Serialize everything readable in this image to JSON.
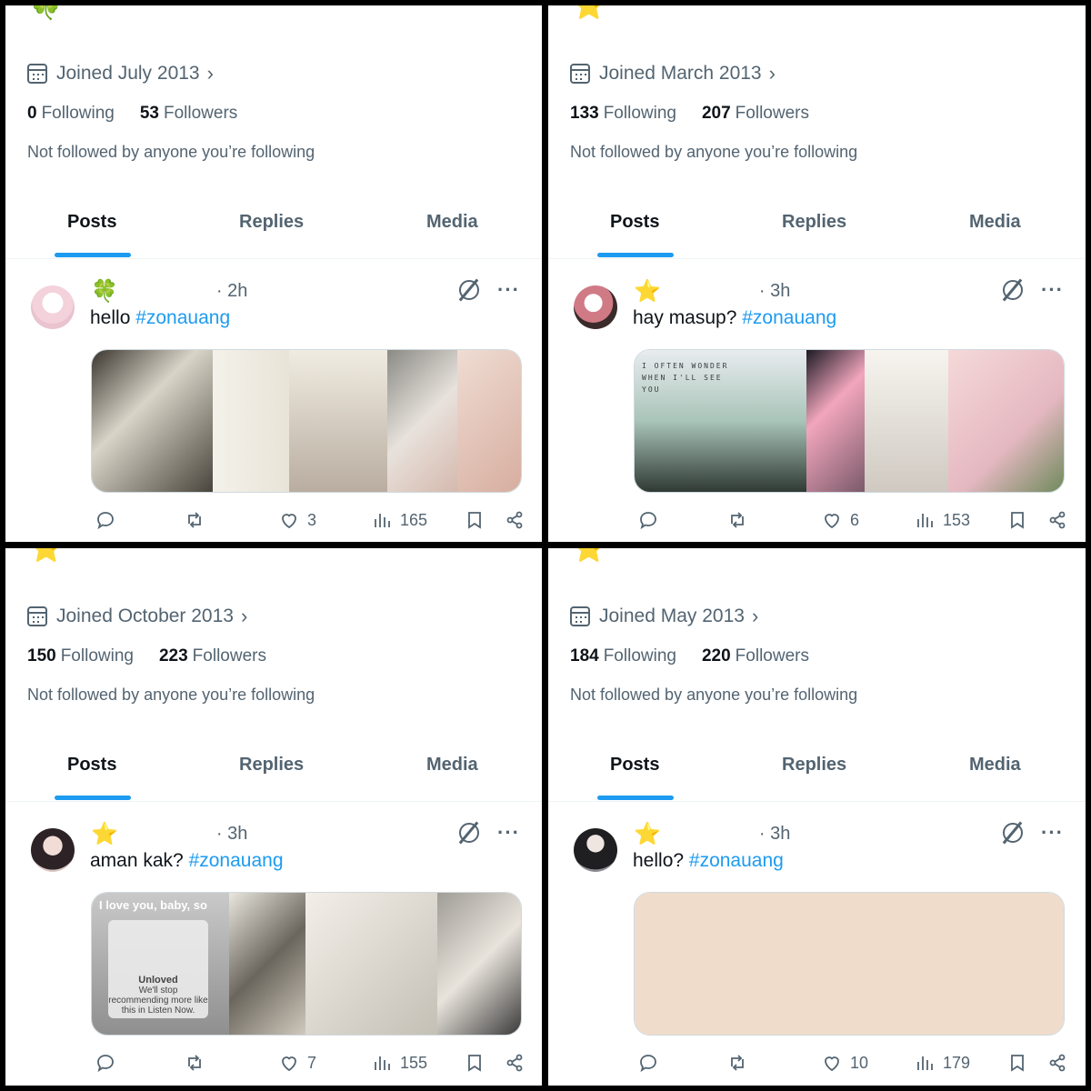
{
  "panels": [
    {
      "top_emoji": "🍀",
      "joined": "Joined July 2013",
      "following_count": "0",
      "following_label": "Following",
      "followers_count": "53",
      "followers_label": "Followers",
      "not_followed": "Not followed by anyone you’re following",
      "tabs": [
        "Posts",
        "Replies",
        "Media"
      ],
      "post": {
        "name_emoji": "🍀",
        "time": "· 2h",
        "text": "hello ",
        "hashtag": "#zonauang",
        "replies": "",
        "reposts": "",
        "likes": "3",
        "views": "165"
      }
    },
    {
      "top_emoji": "⭐",
      "joined": "Joined March 2013",
      "following_count": "133",
      "following_label": "Following",
      "followers_count": "207",
      "followers_label": "Followers",
      "not_followed": "Not followed by anyone you’re following",
      "tabs": [
        "Posts",
        "Replies",
        "Media"
      ],
      "post": {
        "name_emoji": "⭐",
        "time": "· 3h",
        "text": "hay masup? ",
        "hashtag": "#zonauang",
        "replies": "",
        "reposts": "",
        "likes": "6",
        "views": "153"
      }
    },
    {
      "top_emoji": "⭐",
      "joined": "Joined October 2013",
      "following_count": "150",
      "following_label": "Following",
      "followers_count": "223",
      "followers_label": "Followers",
      "not_followed": "Not followed by anyone you’re following",
      "tabs": [
        "Posts",
        "Replies",
        "Media"
      ],
      "post": {
        "name_emoji": "⭐",
        "time": "· 3h",
        "text": "aman kak? ",
        "hashtag": "#zonauang",
        "replies": "",
        "reposts": "",
        "likes": "7",
        "views": "155"
      }
    },
    {
      "top_emoji": "⭐",
      "joined": "Joined May 2013",
      "following_count": "184",
      "following_label": "Following",
      "followers_count": "220",
      "followers_label": "Followers",
      "not_followed": "Not followed by anyone you’re following",
      "tabs": [
        "Posts",
        "Replies",
        "Media"
      ],
      "post": {
        "name_emoji": "⭐",
        "time": "· 3h",
        "text": "hello? ",
        "hashtag": "#zonauang",
        "replies": "",
        "reposts": "",
        "likes": "10",
        "views": "179"
      }
    }
  ],
  "media_text": {
    "p2_overlay": "I love you, baby, so",
    "p2_card_title": "Unloved",
    "p2_card_body": "We'll stop recommending more like this in Listen Now.",
    "p1_overlay": "I OFTEN WONDER WHEN I'LL SEE YOU"
  },
  "colors": {
    "accent": "#1d9bf0",
    "muted_text": "#536471",
    "primary_text": "#0f1419",
    "border": "#cfd9de",
    "divider": "#000000",
    "star": "#f5a623",
    "clover": "#3aa63a",
    "placeholder_media": "#f0dccb"
  },
  "icons": [
    "calendar-icon",
    "chevron-right-icon",
    "grok-icon",
    "more-icon",
    "reply-icon",
    "repost-icon",
    "like-icon",
    "views-icon",
    "bookmark-icon",
    "share-icon"
  ]
}
